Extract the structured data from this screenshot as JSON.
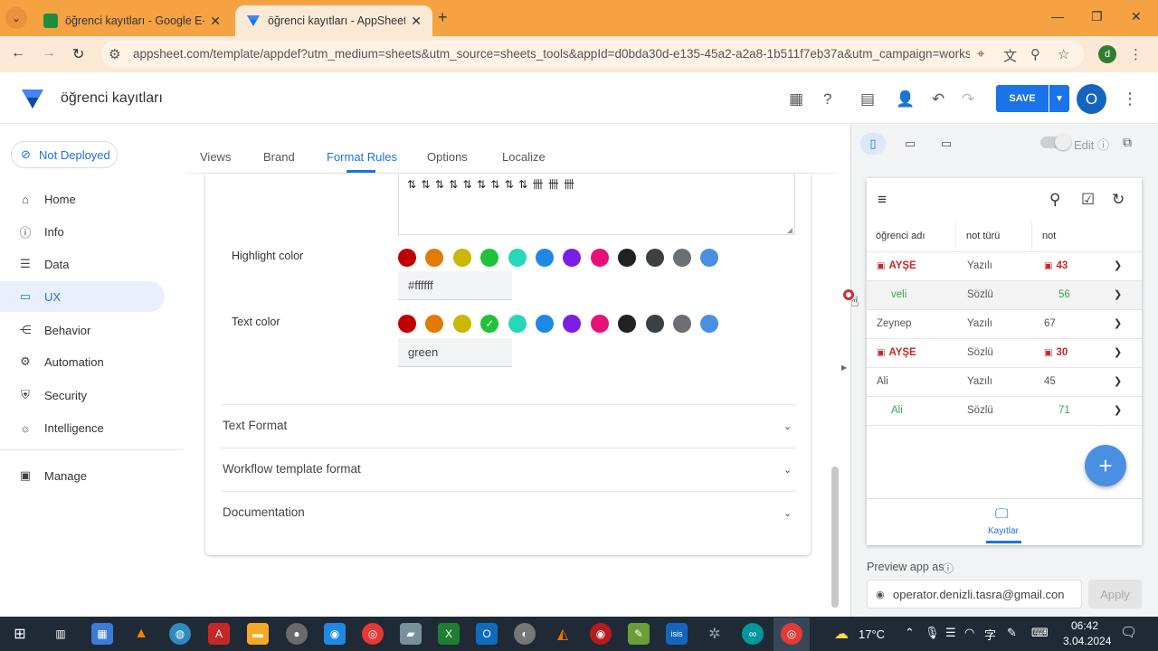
{
  "browser": {
    "tabs": [
      {
        "title": "öğrenci kayıtları - Google E-Tab",
        "active": false
      },
      {
        "title": "öğrenci kayıtları - AppSheet",
        "active": true
      }
    ],
    "url": "appsheet.com/template/appdef?utm_medium=sheets&utm_source=sheets_tools&appId=d0bda30d-e135-45a2-a2a8-1b511f7eb37a&utm_campaign=worksp...",
    "profile_letter": "d"
  },
  "app": {
    "name": "öğrenci kayıtları",
    "save_label": "SAVE",
    "avatar_letter": "O"
  },
  "sidebar": {
    "deploy_status": "Not Deployed",
    "items": [
      {
        "label": "Home",
        "icon": "home-icon"
      },
      {
        "label": "Info",
        "icon": "info-icon"
      },
      {
        "label": "Data",
        "icon": "data-icon"
      },
      {
        "label": "UX",
        "icon": "ux-icon",
        "active": true
      },
      {
        "label": "Behavior",
        "icon": "behavior-icon"
      },
      {
        "label": "Automation",
        "icon": "automation-icon"
      },
      {
        "label": "Security",
        "icon": "shield-icon"
      },
      {
        "label": "Intelligence",
        "icon": "bulb-icon"
      }
    ],
    "manage_label": "Manage"
  },
  "content_tabs": [
    "Views",
    "Brand",
    "Format Rules",
    "Options",
    "Localize"
  ],
  "format_rule": {
    "highlight_label": "Highlight color",
    "highlight_value": "#ffffff",
    "text_color_label": "Text color",
    "text_color_value": "green",
    "palette": [
      "#c00000",
      "#e07b00",
      "#c8b800",
      "#22c13a",
      "#26d7b8",
      "#1e88e5",
      "#7b1fe8",
      "#e8117a",
      "#202124",
      "#3c4043",
      "#6b6f73",
      "#4a90e2"
    ],
    "sections": [
      "Text Format",
      "Workflow template format",
      "Documentation"
    ]
  },
  "preview": {
    "edit_label": "Edit",
    "columns": [
      "öğrenci adı",
      "not türü",
      "not"
    ],
    "rows": [
      {
        "name": "AYŞE",
        "type": "Yazılı",
        "grade": "43",
        "style": "red"
      },
      {
        "name": "veli",
        "type": "Sözlü",
        "grade": "56",
        "style": "green"
      },
      {
        "name": "Zeynep",
        "type": "Yazılı",
        "grade": "67",
        "style": "plain"
      },
      {
        "name": "AYŞE",
        "type": "Sözlü",
        "grade": "30",
        "style": "red"
      },
      {
        "name": "Ali",
        "type": "Yazılı",
        "grade": "45",
        "style": "plain"
      },
      {
        "name": "Ali",
        "type": "Sözlü",
        "grade": "71",
        "style": "green"
      }
    ],
    "bottom_nav_label": "Kayıtlar",
    "preview_as_label": "Preview app as",
    "email": "operator.denizli.tasra@gmail.con",
    "apply_label": "Apply"
  },
  "taskbar": {
    "weather": "17°C",
    "time": "06:42",
    "date": "3.04.2024"
  }
}
